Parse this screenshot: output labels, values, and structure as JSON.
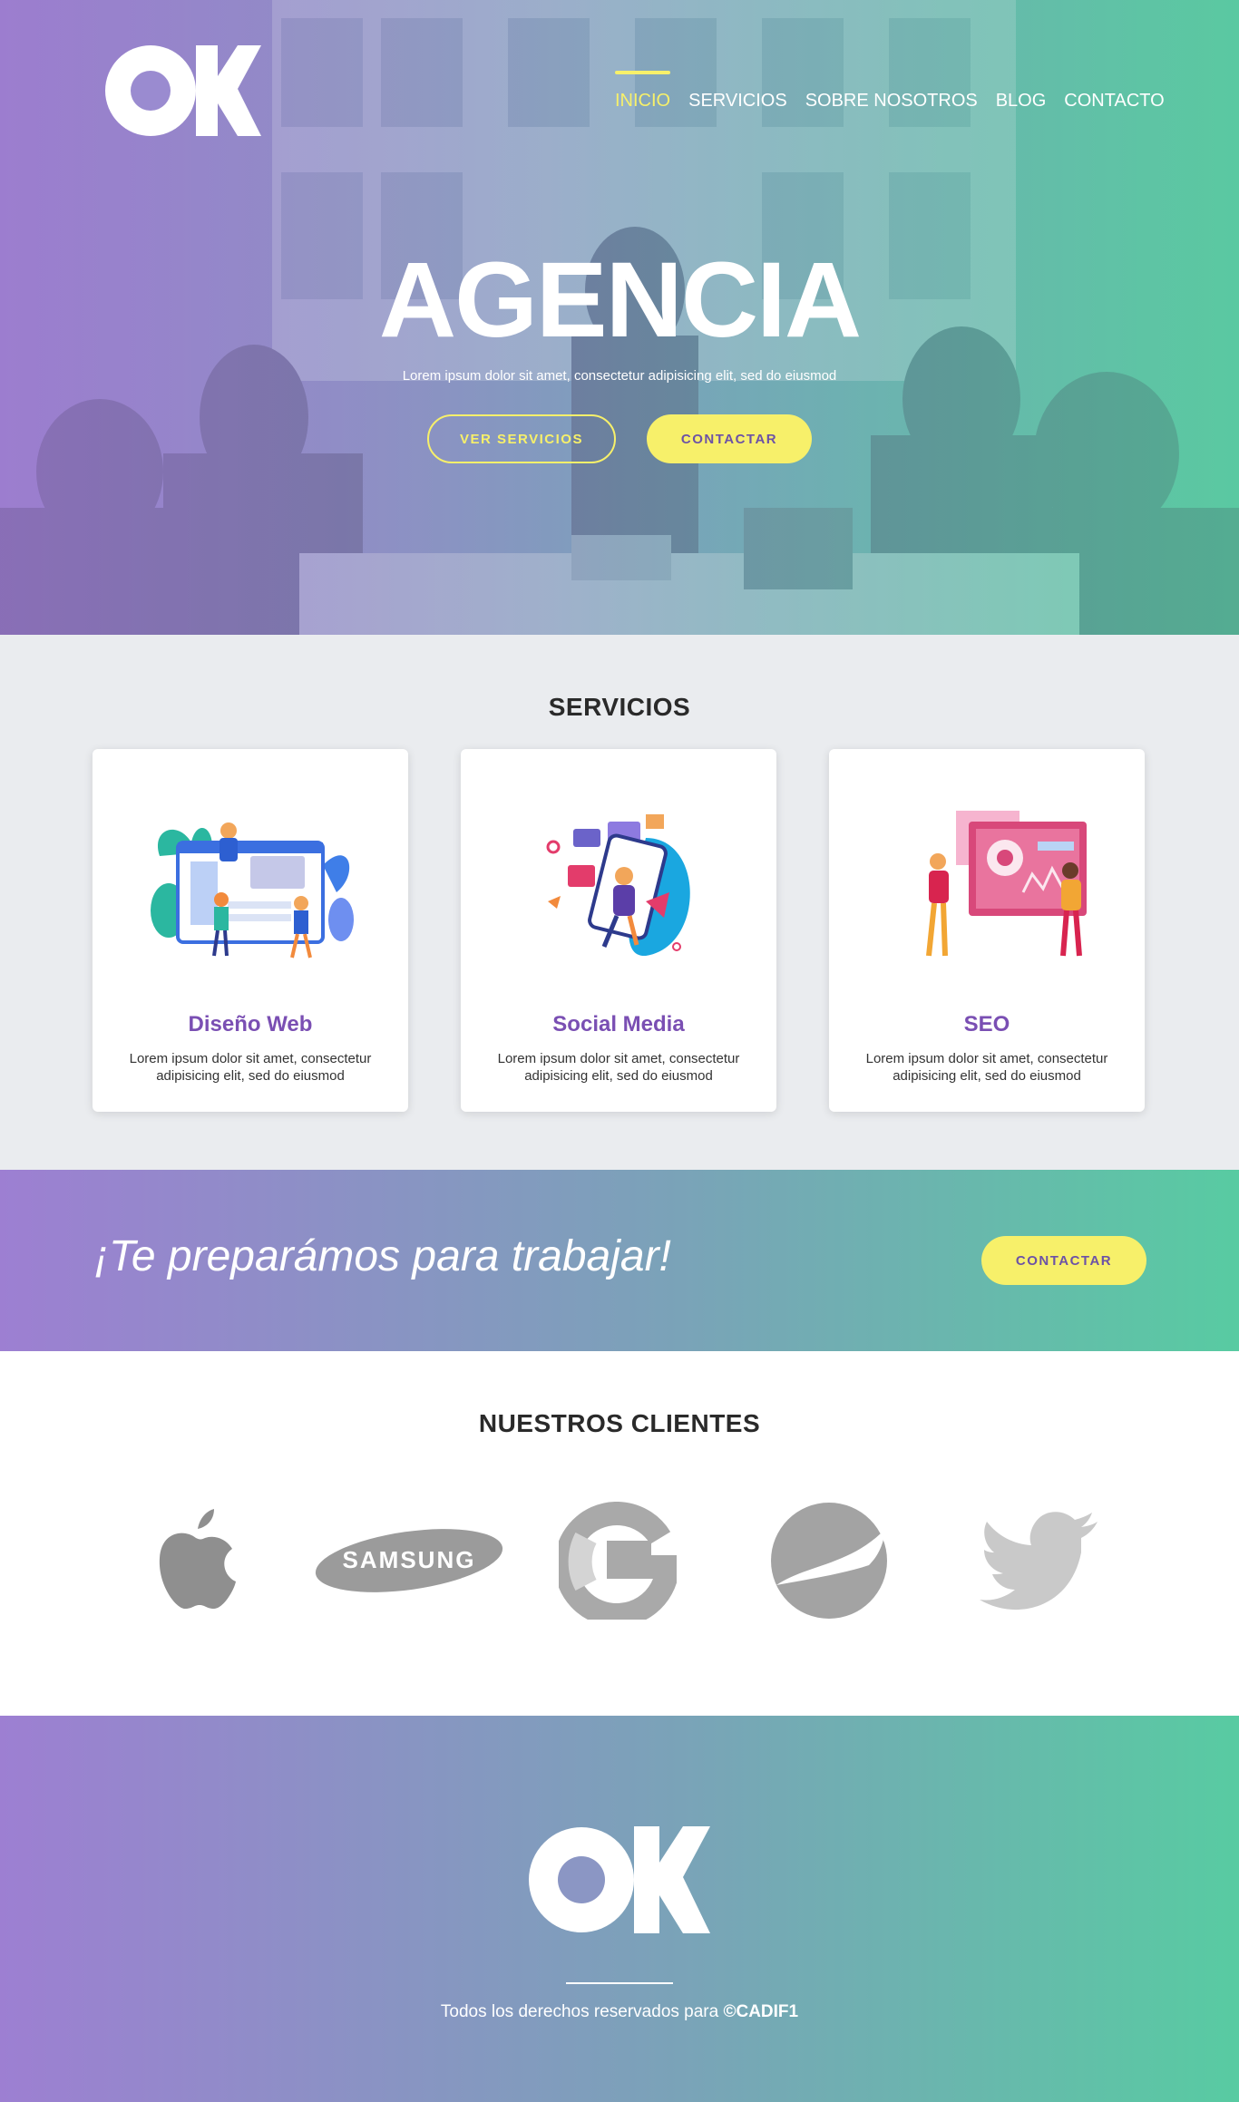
{
  "brand": {
    "logo_text": "OK"
  },
  "nav": {
    "items": [
      {
        "label": "INICIO",
        "active": true
      },
      {
        "label": "SERVICIOS",
        "active": false
      },
      {
        "label": "SOBRE NOSOTROS",
        "active": false
      },
      {
        "label": "BLOG",
        "active": false
      },
      {
        "label": "CONTACTO",
        "active": false
      }
    ]
  },
  "hero": {
    "title": "AGENCIA",
    "subtitle": "Lorem ipsum dolor sit amet, consectetur adipisicing elit, sed do eiusmod",
    "primary_button": "VER SERVICIOS",
    "secondary_button": "CONTACTAR"
  },
  "services": {
    "title": "SERVICIOS",
    "cards": [
      {
        "title": "Diseño Web",
        "icon": "web-design-illustration",
        "description": "Lorem ipsum dolor sit amet, consectetur adipisicing elit, sed do eiusmod"
      },
      {
        "title": "Social Media",
        "icon": "social-media-illustration",
        "description": "Lorem ipsum dolor sit amet, consectetur adipisicing elit, sed do eiusmod"
      },
      {
        "title": "SEO",
        "icon": "seo-illustration",
        "description": "Lorem ipsum dolor sit amet, consectetur adipisicing elit, sed do eiusmod"
      }
    ]
  },
  "cta": {
    "text": "¡Te preparámos para trabajar!",
    "button": "CONTACTAR"
  },
  "clients": {
    "title": "NUESTROS CLIENTES",
    "logos": [
      {
        "name": "apple-logo"
      },
      {
        "name": "samsung-logo",
        "text": "SAMSUNG"
      },
      {
        "name": "google-logo"
      },
      {
        "name": "pepsi-logo"
      },
      {
        "name": "twitter-logo"
      }
    ]
  },
  "footer": {
    "text": "Todos los derechos reservados para ",
    "owner": "©CADIF1"
  },
  "colors": {
    "accent_yellow": "#f7f06a",
    "purple": "#9d7fd2",
    "green": "#58cba2",
    "card_title": "#7a4fb3",
    "gray_section": "#eaecef"
  }
}
